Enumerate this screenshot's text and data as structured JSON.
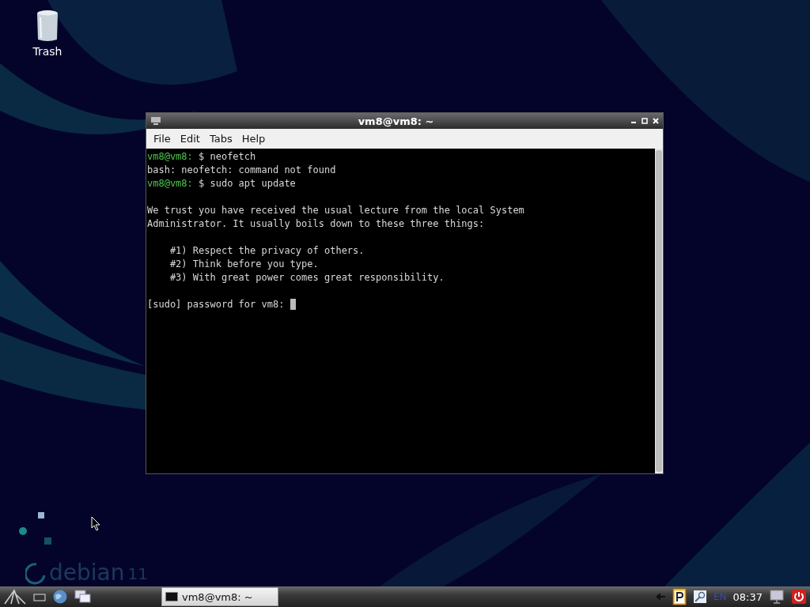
{
  "desktop_icons": [
    {
      "label": "Trash"
    }
  ],
  "wallpaper": {
    "logo_text": "debian",
    "version": "11"
  },
  "window": {
    "title": "vm8@vm8: ~",
    "menu": [
      "File",
      "Edit",
      "Tabs",
      "Help"
    ],
    "lines": [
      {
        "kind": "prompt",
        "user": "vm8@vm8:",
        "command": " $ neofetch"
      },
      {
        "kind": "output",
        "text": "bash: neofetch: command not found"
      },
      {
        "kind": "prompt",
        "user": "vm8@vm8:",
        "command": " $ sudo apt update"
      },
      {
        "kind": "blank"
      },
      {
        "kind": "output",
        "text": "We trust you have received the usual lecture from the local System"
      },
      {
        "kind": "output",
        "text": "Administrator. It usually boils down to these three things:"
      },
      {
        "kind": "blank"
      },
      {
        "kind": "output",
        "text": "    #1) Respect the privacy of others."
      },
      {
        "kind": "output",
        "text": "    #2) Think before you type."
      },
      {
        "kind": "output",
        "text": "    #3) With great power comes great responsibility."
      },
      {
        "kind": "blank"
      },
      {
        "kind": "input",
        "text": "[sudo] password for vm8: "
      }
    ]
  },
  "taskbar": {
    "tasks": [
      {
        "label": "vm8@vm8: ~",
        "selected": true
      }
    ],
    "language": "EN",
    "clock": "08:37"
  }
}
